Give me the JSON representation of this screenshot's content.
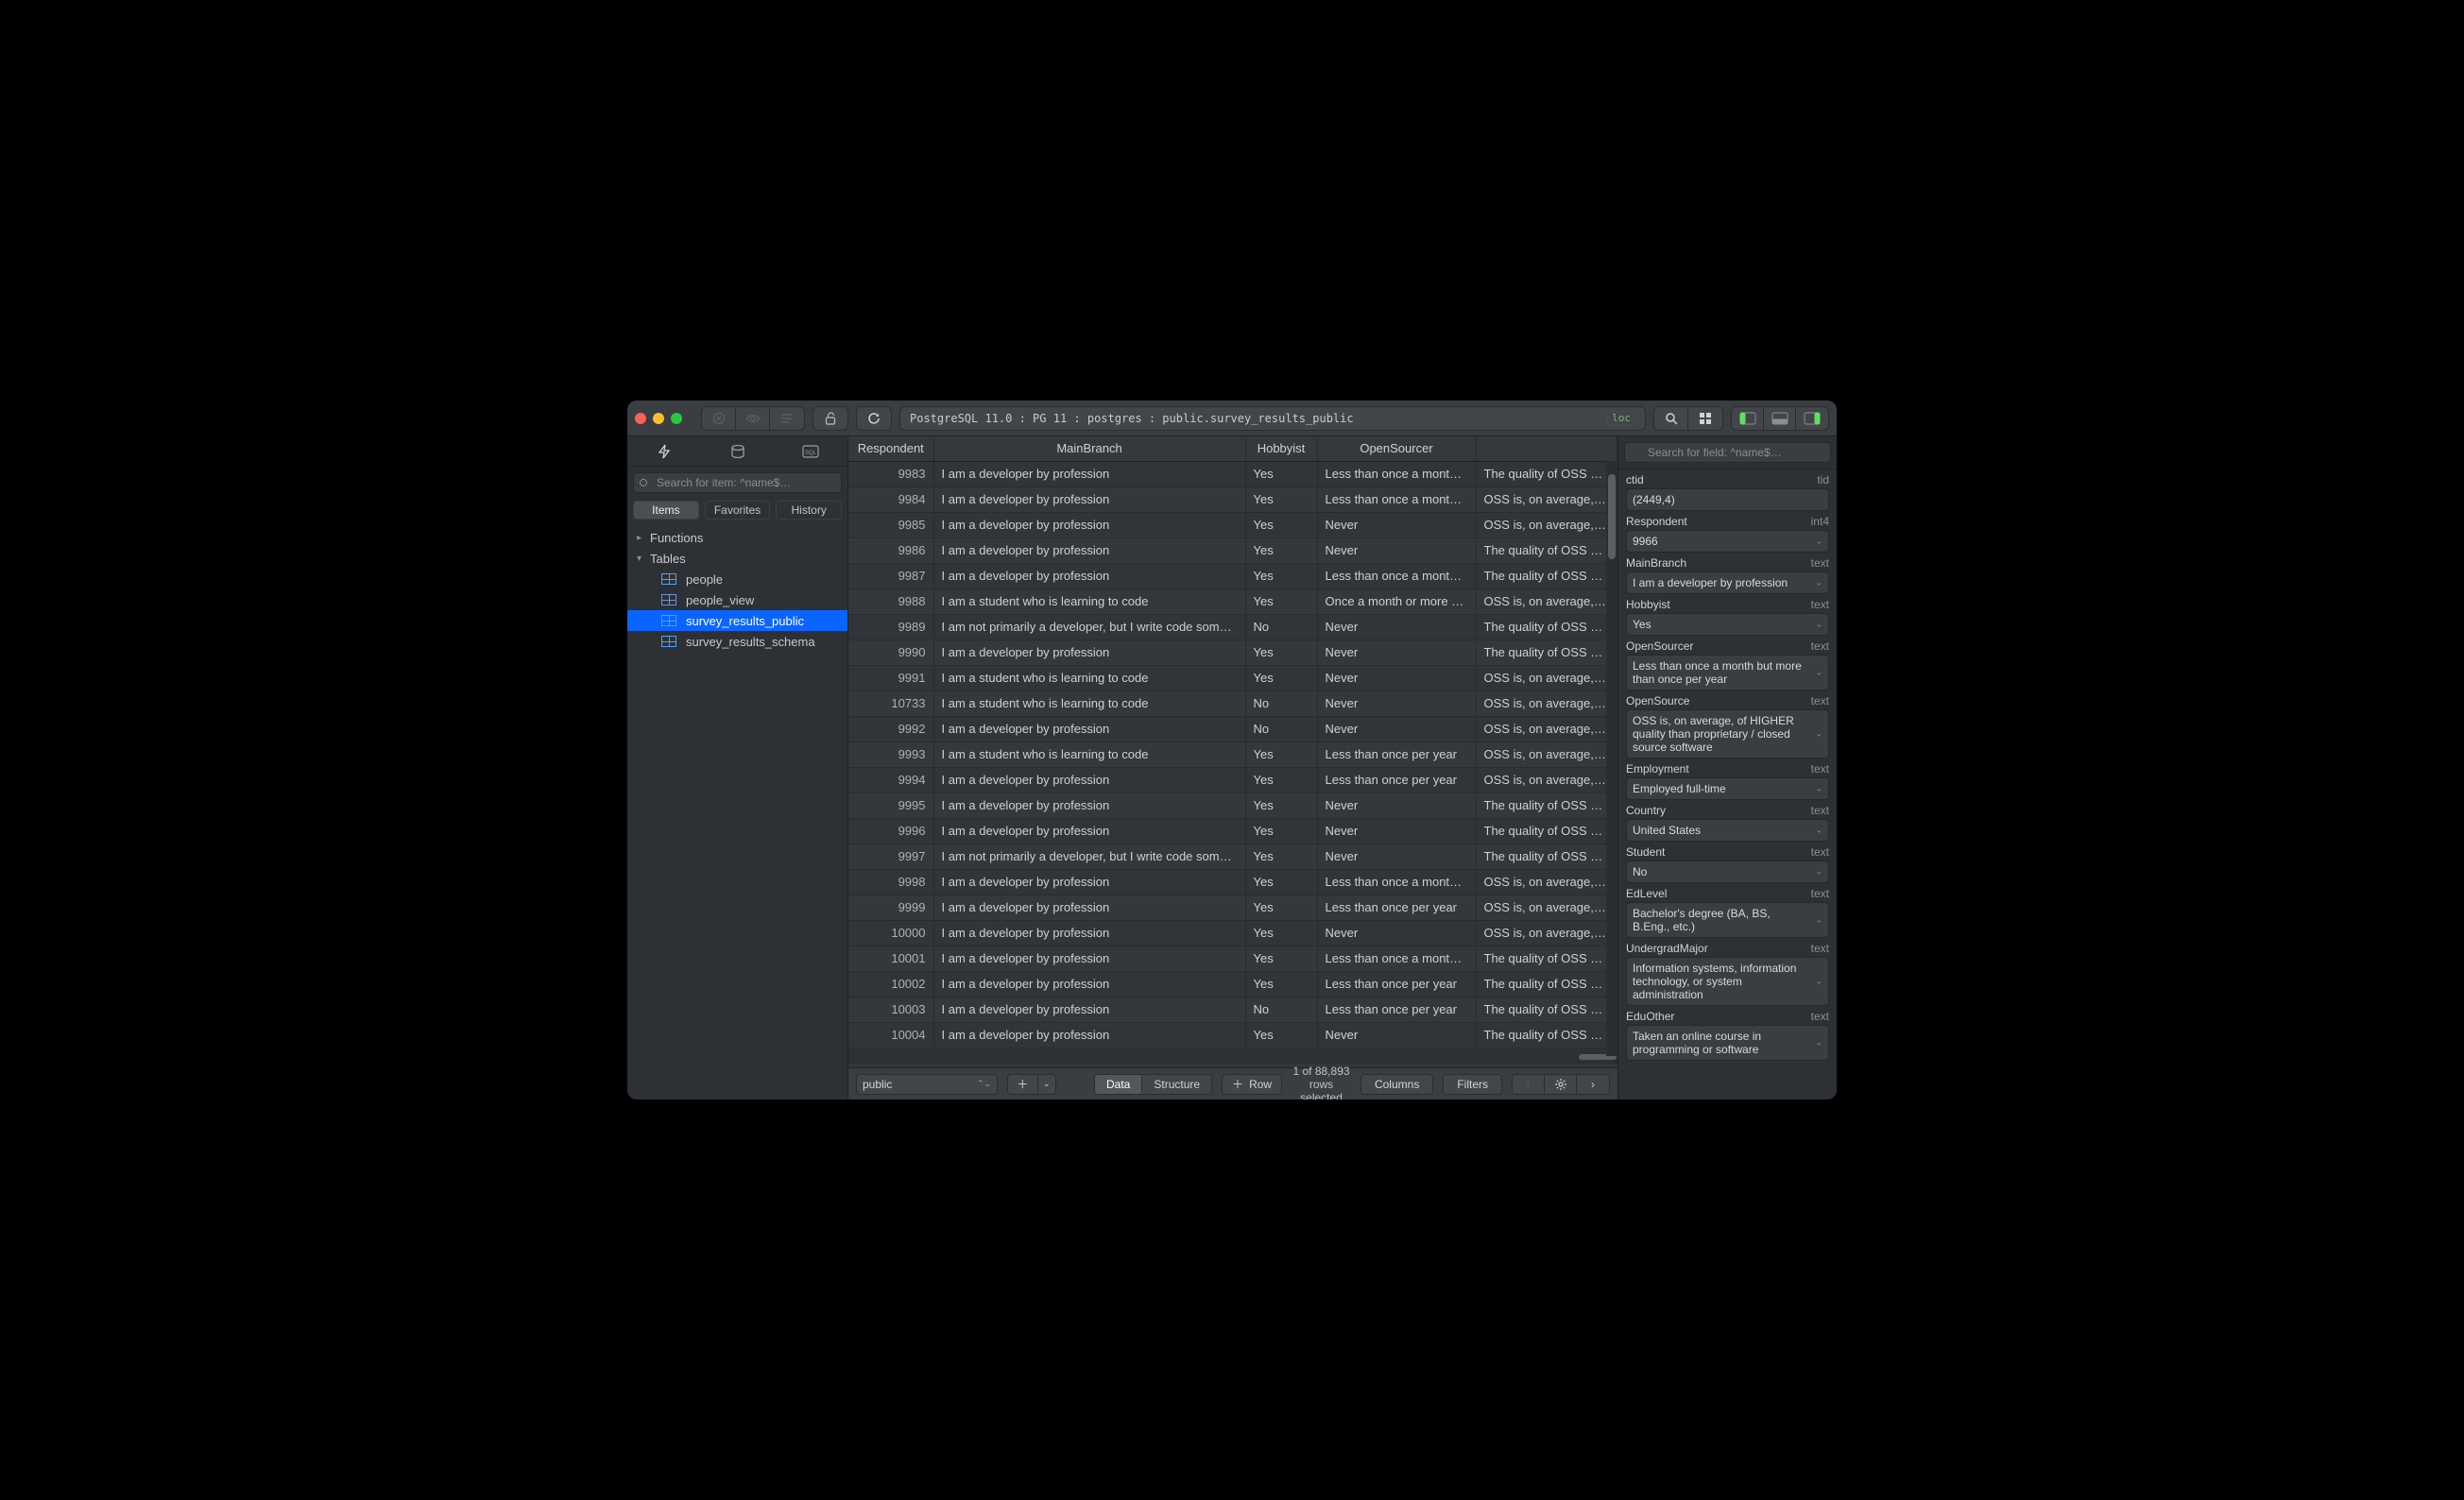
{
  "titlebar": {
    "path": "PostgreSQL 11.0 : PG 11 : postgres : public.survey_results_public",
    "loc_badge": "loc"
  },
  "sidebar": {
    "search_placeholder": "Search for item: ^name$…",
    "tabs": {
      "items": "Items",
      "favorites": "Favorites",
      "history": "History"
    },
    "functions_label": "Functions",
    "tables_label": "Tables",
    "tables": [
      {
        "name": "people"
      },
      {
        "name": "people_view"
      },
      {
        "name": "survey_results_public"
      },
      {
        "name": "survey_results_schema"
      }
    ]
  },
  "grid": {
    "headers": [
      "Respondent",
      "MainBranch",
      "Hobbyist",
      "OpenSourcer",
      ""
    ],
    "rows": [
      {
        "r": "9983",
        "m": "I am a developer by profession",
        "h": "Yes",
        "s": "Less than once a month b…",
        "o": "The quality of OSS a…"
      },
      {
        "r": "9984",
        "m": "I am a developer by profession",
        "h": "Yes",
        "s": "Less than once a month b…",
        "o": "OSS is, on average, …"
      },
      {
        "r": "9985",
        "m": "I am a developer by profession",
        "h": "Yes",
        "s": "Never",
        "o": "OSS is, on average, …"
      },
      {
        "r": "9986",
        "m": "I am a developer by profession",
        "h": "Yes",
        "s": "Never",
        "o": "The quality of OSS a…"
      },
      {
        "r": "9987",
        "m": "I am a developer by profession",
        "h": "Yes",
        "s": "Less than once a month b…",
        "o": "The quality of OSS a…"
      },
      {
        "r": "9988",
        "m": "I am a student who is learning to code",
        "h": "Yes",
        "s": "Once a month or more often",
        "o": "OSS is, on average, …"
      },
      {
        "r": "9989",
        "m": "I am not primarily a developer, but I write code somet…",
        "h": "No",
        "s": "Never",
        "o": "The quality of OSS a…"
      },
      {
        "r": "9990",
        "m": "I am a developer by profession",
        "h": "Yes",
        "s": "Never",
        "o": "The quality of OSS a…"
      },
      {
        "r": "9991",
        "m": "I am a student who is learning to code",
        "h": "Yes",
        "s": "Never",
        "o": "OSS is, on average, …"
      },
      {
        "r": "10733",
        "m": "I am a student who is learning to code",
        "h": "No",
        "s": "Never",
        "o": "OSS is, on average, …"
      },
      {
        "r": "9992",
        "m": "I am a developer by profession",
        "h": "No",
        "s": "Never",
        "o": "OSS is, on average, …"
      },
      {
        "r": "9993",
        "m": "I am a student who is learning to code",
        "h": "Yes",
        "s": "Less than once per year",
        "o": "OSS is, on average, …"
      },
      {
        "r": "9994",
        "m": "I am a developer by profession",
        "h": "Yes",
        "s": "Less than once per year",
        "o": "OSS is, on average, …"
      },
      {
        "r": "9995",
        "m": "I am a developer by profession",
        "h": "Yes",
        "s": "Never",
        "o": "The quality of OSS a…"
      },
      {
        "r": "9996",
        "m": "I am a developer by profession",
        "h": "Yes",
        "s": "Never",
        "o": "The quality of OSS a…"
      },
      {
        "r": "9997",
        "m": "I am not primarily a developer, but I write code somet…",
        "h": "Yes",
        "s": "Never",
        "o": "The quality of OSS a…"
      },
      {
        "r": "9998",
        "m": "I am a developer by profession",
        "h": "Yes",
        "s": "Less than once a month b…",
        "o": "OSS is, on average, …"
      },
      {
        "r": "9999",
        "m": "I am a developer by profession",
        "h": "Yes",
        "s": "Less than once per year",
        "o": "OSS is, on average, …"
      },
      {
        "r": "10000",
        "m": "I am a developer by profession",
        "h": "Yes",
        "s": "Never",
        "o": "OSS is, on average, …"
      },
      {
        "r": "10001",
        "m": "I am a developer by profession",
        "h": "Yes",
        "s": "Less than once a month b…",
        "o": "The quality of OSS a…"
      },
      {
        "r": "10002",
        "m": "I am a developer by profession",
        "h": "Yes",
        "s": "Less than once per year",
        "o": "The quality of OSS a…"
      },
      {
        "r": "10003",
        "m": "I am a developer by profession",
        "h": "No",
        "s": "Less than once per year",
        "o": "The quality of OSS a…"
      },
      {
        "r": "10004",
        "m": "I am a developer by profession",
        "h": "Yes",
        "s": "Never",
        "o": "The quality of OSS a…"
      }
    ]
  },
  "bottom": {
    "schema": "public",
    "data": "Data",
    "structure": "Structure",
    "row": "Row",
    "status": "1 of 88,893 rows selected",
    "columns": "Columns",
    "filters": "Filters"
  },
  "inspector": {
    "search_placeholder": "Search for field: ^name$…",
    "fields": [
      {
        "name": "ctid",
        "type": "tid",
        "value": "(2449,4)",
        "caret": false
      },
      {
        "name": "Respondent",
        "type": "int4",
        "value": "9966",
        "caret": true
      },
      {
        "name": "MainBranch",
        "type": "text",
        "value": "I am a developer by profession",
        "caret": true
      },
      {
        "name": "Hobbyist",
        "type": "text",
        "value": "Yes",
        "caret": true
      },
      {
        "name": "OpenSourcer",
        "type": "text",
        "value": "Less than once a month but more than once per year",
        "caret": true
      },
      {
        "name": "OpenSource",
        "type": "text",
        "value": "OSS is, on average, of HIGHER quality than proprietary / closed source software",
        "caret": true
      },
      {
        "name": "Employment",
        "type": "text",
        "value": "Employed full-time",
        "caret": true
      },
      {
        "name": "Country",
        "type": "text",
        "value": "United States",
        "caret": true
      },
      {
        "name": "Student",
        "type": "text",
        "value": "No",
        "caret": true
      },
      {
        "name": "EdLevel",
        "type": "text",
        "value": "Bachelor's degree (BA, BS, B.Eng., etc.)",
        "caret": true
      },
      {
        "name": "UndergradMajor",
        "type": "text",
        "value": "Information systems, information technology, or system administration",
        "caret": true
      },
      {
        "name": "EduOther",
        "type": "text",
        "value": "Taken an online course in programming or software",
        "caret": true
      }
    ]
  }
}
